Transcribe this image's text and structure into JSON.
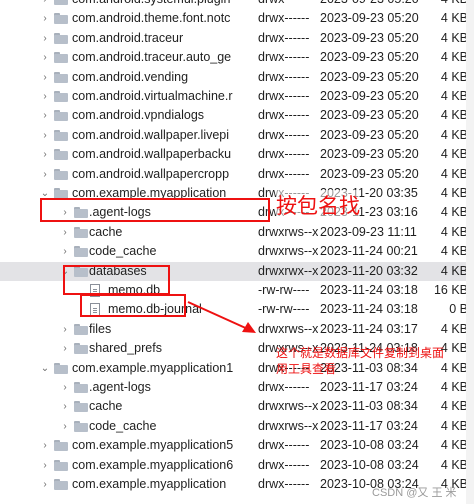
{
  "rows": [
    {
      "name": "com.android.systemui.plugin",
      "perms": "drwx------",
      "date": "2023-09-23 05:20",
      "size": "4 KB",
      "depth": 0,
      "chev": "›",
      "icon": "folder"
    },
    {
      "name": "com.android.theme.font.notc",
      "perms": "drwx------",
      "date": "2023-09-23 05:20",
      "size": "4 KB",
      "depth": 0,
      "chev": "›",
      "icon": "folder"
    },
    {
      "name": "com.android.traceur",
      "perms": "drwx------",
      "date": "2023-09-23 05:20",
      "size": "4 KB",
      "depth": 0,
      "chev": "›",
      "icon": "folder"
    },
    {
      "name": "com.android.traceur.auto_ge",
      "perms": "drwx------",
      "date": "2023-09-23 05:20",
      "size": "4 KB",
      "depth": 0,
      "chev": "›",
      "icon": "folder"
    },
    {
      "name": "com.android.vending",
      "perms": "drwx------",
      "date": "2023-09-23 05:20",
      "size": "4 KB",
      "depth": 0,
      "chev": "›",
      "icon": "folder"
    },
    {
      "name": "com.android.virtualmachine.r",
      "perms": "drwx------",
      "date": "2023-09-23 05:20",
      "size": "4 KB",
      "depth": 0,
      "chev": "›",
      "icon": "folder"
    },
    {
      "name": "com.android.vpndialogs",
      "perms": "drwx------",
      "date": "2023-09-23 05:20",
      "size": "4 KB",
      "depth": 0,
      "chev": "›",
      "icon": "folder"
    },
    {
      "name": "com.android.wallpaper.livepi",
      "perms": "drwx------",
      "date": "2023-09-23 05:20",
      "size": "4 KB",
      "depth": 0,
      "chev": "›",
      "icon": "folder"
    },
    {
      "name": "com.android.wallpaperbacku",
      "perms": "drwx------",
      "date": "2023-09-23 05:20",
      "size": "4 KB",
      "depth": 0,
      "chev": "›",
      "icon": "folder"
    },
    {
      "name": "com.android.wallpapercropp",
      "perms": "drwx------",
      "date": "2023-09-23 05:20",
      "size": "4 KB",
      "depth": 0,
      "chev": "›",
      "icon": "folder"
    },
    {
      "name": "com.example.myapplication",
      "perms": "drwx------",
      "date": "2023-11-20 03:35",
      "size": "4 KB",
      "depth": 0,
      "chev": "⌄",
      "icon": "folder"
    },
    {
      "name": ".agent-logs",
      "perms": "drwx------",
      "date": "2023-11-23 03:16",
      "size": "4 KB",
      "depth": 1,
      "chev": "›",
      "icon": "folder"
    },
    {
      "name": "cache",
      "perms": "drwxrws--x",
      "date": "2023-09-23 11:11",
      "size": "4 KB",
      "depth": 1,
      "chev": "›",
      "icon": "folder"
    },
    {
      "name": "code_cache",
      "perms": "drwxrws--x",
      "date": "2023-11-24 00:21",
      "size": "4 KB",
      "depth": 1,
      "chev": "›",
      "icon": "folder"
    },
    {
      "name": "databases",
      "perms": "drwxrwx--x",
      "date": "2023-11-20 03:32",
      "size": "4 KB",
      "depth": 1,
      "chev": "⌄",
      "icon": "folder",
      "selected": true
    },
    {
      "name": "memo.db",
      "perms": "-rw-rw----",
      "date": "2023-11-24 03:18",
      "size": "16 KB",
      "depth": 2,
      "chev": "",
      "icon": "file"
    },
    {
      "name": "memo.db-journal",
      "perms": "-rw-rw----",
      "date": "2023-11-24 03:18",
      "size": "0 B",
      "depth": 2,
      "chev": "",
      "icon": "file"
    },
    {
      "name": "files",
      "perms": "drwxrws--x",
      "date": "2023-11-24 03:17",
      "size": "4 KB",
      "depth": 1,
      "chev": "›",
      "icon": "folder"
    },
    {
      "name": "shared_prefs",
      "perms": "drwxrws--x",
      "date": "2023-11-24 03:18",
      "size": "4 KB",
      "depth": 1,
      "chev": "›",
      "icon": "folder"
    },
    {
      "name": "com.example.myapplication1",
      "perms": "drwx------",
      "date": "2023-11-03 08:34",
      "size": "4 KB",
      "depth": 0,
      "chev": "⌄",
      "icon": "folder"
    },
    {
      "name": ".agent-logs",
      "perms": "drwx------",
      "date": "2023-11-17 03:24",
      "size": "4 KB",
      "depth": 1,
      "chev": "›",
      "icon": "folder"
    },
    {
      "name": "cache",
      "perms": "drwxrws--x",
      "date": "2023-11-03 08:34",
      "size": "4 KB",
      "depth": 1,
      "chev": "›",
      "icon": "folder"
    },
    {
      "name": "code_cache",
      "perms": "drwxrws--x",
      "date": "2023-11-17 03:24",
      "size": "4 KB",
      "depth": 1,
      "chev": "›",
      "icon": "folder"
    },
    {
      "name": "com.example.myapplication5",
      "perms": "drwx------",
      "date": "2023-10-08 03:24",
      "size": "4 KB",
      "depth": 0,
      "chev": "›",
      "icon": "folder"
    },
    {
      "name": "com.example.myapplication6",
      "perms": "drwx------",
      "date": "2023-10-08 03:24",
      "size": "4 KB",
      "depth": 0,
      "chev": "›",
      "icon": "folder"
    },
    {
      "name": "com.example.myapplication",
      "perms": "drwx------",
      "date": "2023-10-08 03:24",
      "size": "4 KB",
      "depth": 0,
      "chev": "›",
      "icon": "folder"
    }
  ],
  "annotations": {
    "package_note": "按包名找",
    "db_note_line1": "这个就是数据库文件复制到桌面",
    "db_note_line2": "用工具查看"
  },
  "watermark": "CSDN @又 王 米",
  "colors": {
    "annotation": "#ee1111",
    "selected_row": "#e3e3e6"
  }
}
